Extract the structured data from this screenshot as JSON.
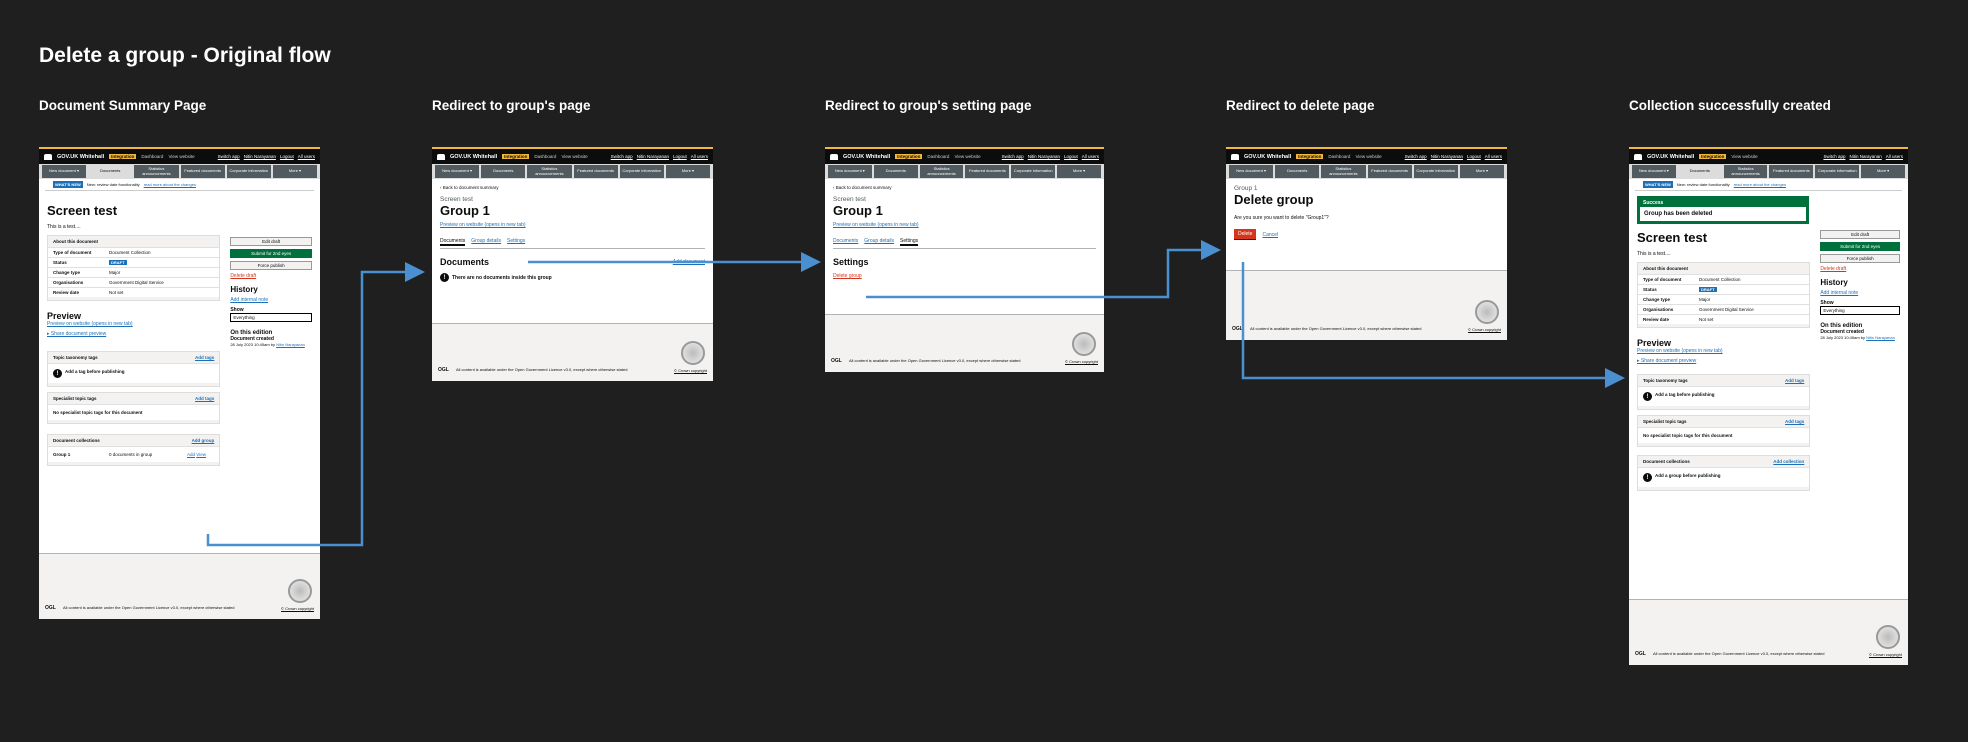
{
  "page_title": "Delete a group - Original flow",
  "steps": [
    "Document Summary Page",
    "Redirect to group's page",
    "Redirect to group's setting page",
    "Redirect to delete page",
    "Collection successfully created"
  ],
  "header": {
    "brand": "GOV.UK Whitehall",
    "env": "Integration",
    "dashboard": "Dashboard",
    "view_website": "View website",
    "switch_app": "Switch app",
    "user": "Nitin Narayanan",
    "logout": "Logout",
    "all_users": "All users"
  },
  "nav": [
    "New document ▾",
    "Documents",
    "Statistics announcements",
    "Featured documents",
    "Corporate information",
    "More ▾"
  ],
  "whats_new": {
    "badge": "WHAT'S NEW",
    "text": "New: review date functionality",
    "link": "read more about the changes"
  },
  "summary": {
    "title": "Screen test",
    "body": "This is a test....",
    "about_heading": "About this document",
    "rows": [
      {
        "k": "Type of document",
        "v": "Document Collection"
      },
      {
        "k": "Status",
        "v": "DRAFT"
      },
      {
        "k": "Change type",
        "v": "Major"
      },
      {
        "k": "Organisations",
        "v": "Government Digital Service"
      },
      {
        "k": "Review date",
        "v": "Not set"
      }
    ],
    "preview_heading": "Preview",
    "preview_link": "Preview on website (opens in new tab)",
    "share_link": "▸ Share document preview",
    "topic_heading": "Topic taxonomy tags",
    "add_tags": "Add tags",
    "topic_msg": "Add a tag before publishing",
    "specialist_heading": "Specialist topic tags",
    "specialist_msg": "No specialist topic tags for this document",
    "collections_heading": "Document collections",
    "add_group": "Add group",
    "group_name": "Group 1",
    "group_docs": "0 documents in group",
    "group_add": "Add",
    "group_view": "View",
    "add_collection": "Add collection",
    "collection_msg": "Add a group before publishing"
  },
  "sidebar": {
    "edit": "Edit draft",
    "submit": "Submit for 2nd eyes",
    "force": "Force publish",
    "delete": "Delete draft",
    "history": "History",
    "add_note": "Add internal note",
    "show": "Show",
    "show_value": "Everything",
    "edition": "On this edition",
    "created": "Document created",
    "created_by": "28 July 2023 10:45am by",
    "created_user": "Nitin Narayanan"
  },
  "group_page": {
    "back": "‹ Back to document summary",
    "caption": "Screen test",
    "title": "Group 1",
    "preview": "Preview on website (opens in new tab)",
    "tabs": [
      "Documents",
      "Group details",
      "Settings"
    ],
    "docs_heading": "Documents",
    "add_document": "Add document",
    "empty": "There are no documents inside this group",
    "settings_heading": "Settings",
    "delete_group": "Delete group"
  },
  "delete_page": {
    "caption": "Group 1",
    "title": "Delete group",
    "question": "Are you sure you want to delete \"Group1\"?",
    "delete": "Delete",
    "cancel": "Cancel"
  },
  "success": {
    "label": "Success",
    "message": "Group has been deleted"
  },
  "footer": {
    "ogl": "OGL",
    "licence": "All content is available under the Open Government Licence v3.0, except where otherwise stated",
    "copyright": "© Crown copyright"
  },
  "colors": {
    "arrow": "#4a8fcf",
    "brand_green": "#00703c",
    "danger": "#d4351c",
    "link": "#1d70b8",
    "env": "#f0b73a"
  }
}
